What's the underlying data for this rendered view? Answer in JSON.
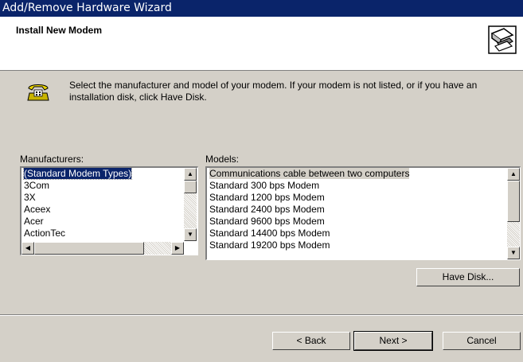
{
  "window": {
    "title": "Add/Remove Hardware Wizard"
  },
  "header": {
    "title": "Install New Modem",
    "icon": "hardware-wizard-icon"
  },
  "instructions": {
    "icon": "telephone-modem-icon",
    "text": "Select the manufacturer and model of your modem. If your modem is not listed, or if you have an installation disk, click Have Disk."
  },
  "manufacturers": {
    "label": "Manufacturers:",
    "items": [
      "(Standard Modem Types)",
      "3Com",
      "3X",
      "Aceex",
      "Acer",
      "ActionTec"
    ],
    "selected": "(Standard Modem Types)"
  },
  "models": {
    "label": "Models:",
    "items": [
      "Communications cable between two computers",
      "Standard   300 bps Modem",
      "Standard  1200 bps Modem",
      "Standard  2400 bps Modem",
      "Standard  9600 bps Modem",
      "Standard 14400 bps Modem",
      "Standard 19200 bps Modem"
    ],
    "selected": "Communications cable between two computers"
  },
  "buttons": {
    "have_disk": "Have Disk...",
    "back": "< Back",
    "next": "Next >",
    "cancel": "Cancel"
  },
  "colors": {
    "titlebar": "#0a246a",
    "face": "#d4d0c8",
    "selection": "#0a246a"
  }
}
